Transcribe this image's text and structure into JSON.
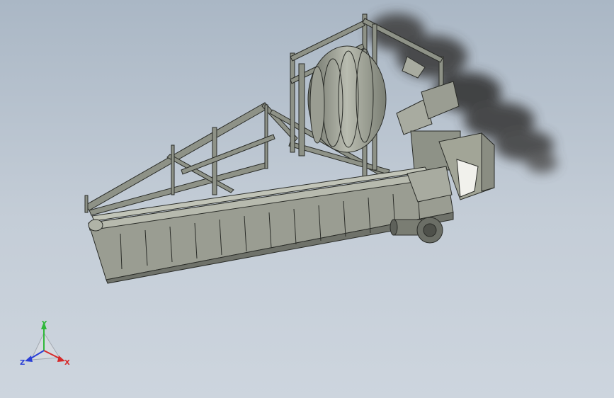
{
  "viewport": {
    "background_top": "#aab7c5",
    "background_bottom": "#cdd5de"
  },
  "model": {
    "icon": "cad-assembly-model",
    "parts": [
      "steel-frame",
      "rotary-drum",
      "chain-conveyor",
      "drive-motor",
      "hood",
      "smoke"
    ]
  },
  "triad": {
    "icon": "axis-triad-icon",
    "x_label": "X",
    "y_label": "Y",
    "z_label": "Z",
    "x_color": "#d62a2a",
    "y_color": "#2fb83a",
    "z_color": "#2a3fd6"
  }
}
